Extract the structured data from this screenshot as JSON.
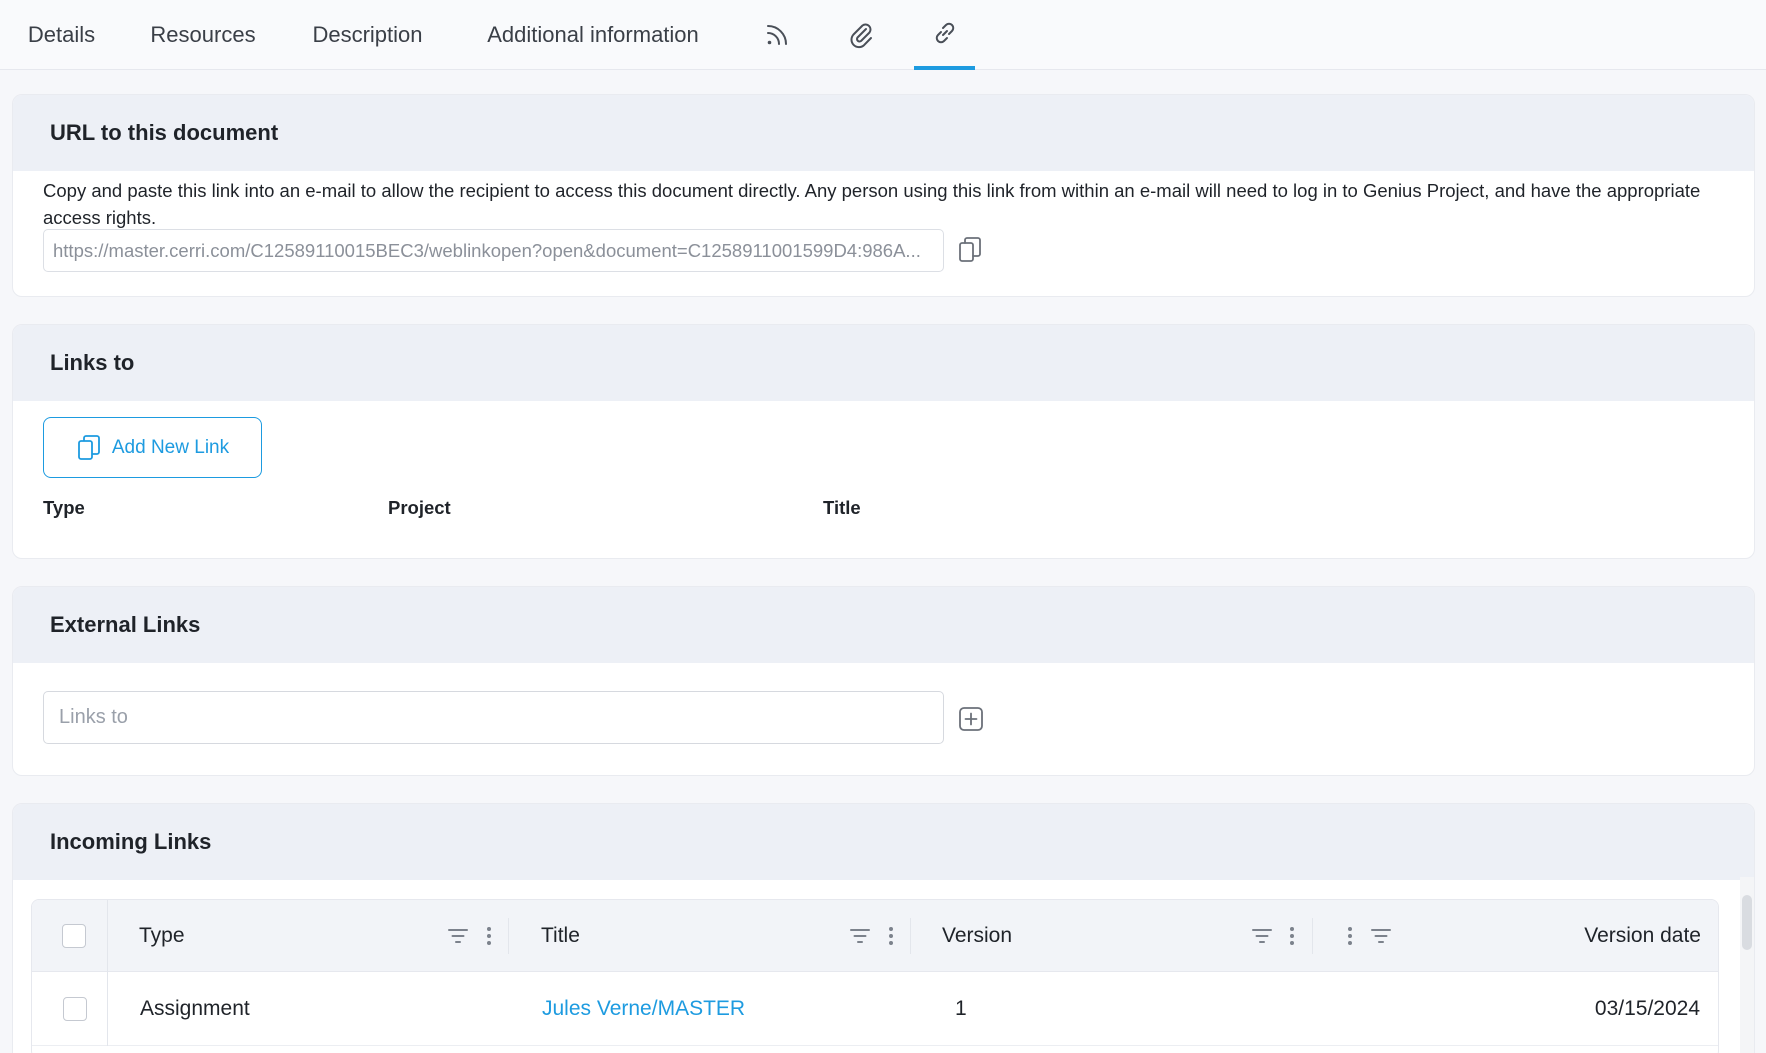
{
  "tabs": [
    {
      "label": "Details"
    },
    {
      "label": "Resources"
    },
    {
      "label": "Description"
    },
    {
      "label": "Additional information"
    },
    {
      "icon": "rss-icon"
    },
    {
      "icon": "paperclip-icon"
    },
    {
      "icon": "link-icon",
      "active": true
    }
  ],
  "url_section": {
    "title": "URL to this document",
    "description": "Copy and paste this link into an e-mail to allow the recipient to access this document directly. Any person using this link from within an e-mail will need to log in to Genius Project, and have the appropriate access rights.",
    "url_value": "https://master.cerri.com/C12589110015BEC3/weblinkopen?open&document=C1258911001599D4:986A...",
    "copy_icon": "copy-icon"
  },
  "links_to": {
    "title": "Links to",
    "add_button": "Add New Link",
    "columns": [
      "Type",
      "Project",
      "Title"
    ]
  },
  "external_links": {
    "title": "External Links",
    "input_placeholder": "Links to",
    "add_icon": "plus-square-icon"
  },
  "incoming_links": {
    "title": "Incoming Links",
    "columns": [
      "Type",
      "Title",
      "Version",
      "Version date"
    ],
    "rows": [
      {
        "type": "Assignment",
        "title": "Jules Verne/MASTER",
        "version": "1",
        "version_date": "03/15/2024"
      }
    ]
  },
  "colors": {
    "accent": "#1d9be0",
    "header_bg": "#edf0f6"
  }
}
